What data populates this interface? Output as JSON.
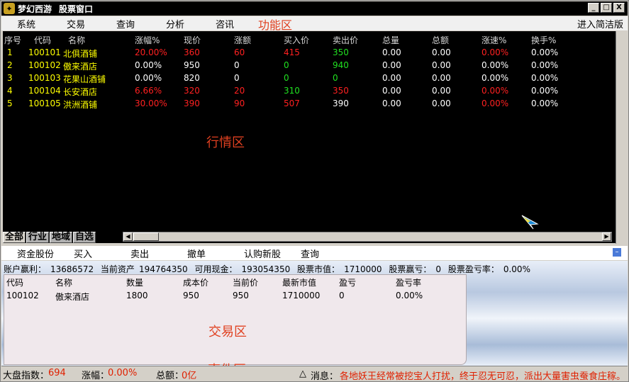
{
  "window": {
    "title": "梦幻西游",
    "subtitle": "股票窗口",
    "min": "_",
    "max": "□",
    "close": "X"
  },
  "menubar": {
    "items": [
      "系统",
      "交易",
      "查询",
      "分析",
      "咨讯"
    ],
    "zone_label": "功能区",
    "simple_mode": "进入简洁版"
  },
  "quote": {
    "headers": [
      "序号",
      "代码",
      "名称",
      "涨幅%",
      "现价",
      "涨额",
      "买入价",
      "卖出价",
      "总量",
      "总额",
      "涨速%",
      "换手%"
    ],
    "rows": [
      [
        "1",
        "100101",
        "北俱酒铺",
        "20.00%",
        "360",
        "60",
        "415",
        "350",
        "0.00",
        "0.00",
        "0.00%",
        "0.00%"
      ],
      [
        "2",
        "100102",
        "傲来酒店",
        "0.00%",
        "950",
        "0",
        "0",
        "940",
        "0.00",
        "0.00",
        "0.00%",
        "0.00%"
      ],
      [
        "3",
        "100103",
        "花果山酒铺",
        "0.00%",
        "820",
        "0",
        "0",
        "0",
        "0.00",
        "0.00",
        "0.00%",
        "0.00%"
      ],
      [
        "4",
        "100104",
        "长安酒店",
        "6.66%",
        "320",
        "20",
        "310",
        "350",
        "0.00",
        "0.00",
        "0.00%",
        "0.00%"
      ],
      [
        "5",
        "100105",
        "洪洲酒铺",
        "30.00%",
        "390",
        "90",
        "507",
        "390",
        "0.00",
        "0.00",
        "0.00%",
        "0.00%"
      ]
    ],
    "zone_label": "行情区"
  },
  "tabs": [
    "全部",
    "行业",
    "地域",
    "自选"
  ],
  "trademenu": {
    "items": [
      "资金股份",
      "买入",
      "卖出",
      "撤单",
      "认购新股",
      "查询"
    ]
  },
  "account": {
    "profit_label": "账户赢利：",
    "profit": "13686572",
    "assets_label": "当前资产",
    "assets": "194764350",
    "cash_label": "可用现金：",
    "cash": "193054350",
    "market_label": "股票市值：",
    "market": "1710000",
    "gain_label": "股票赢亏：",
    "gain": "0",
    "rate_label": "股票盈亏率：",
    "rate": "0.00%"
  },
  "holdings": {
    "headers": [
      "代码",
      "名称",
      "数量",
      "成本价",
      "当前价",
      "最新市值",
      "盈亏",
      "盈亏率"
    ],
    "rows": [
      [
        "100102",
        "傲来酒店",
        "1800",
        "950",
        "950",
        "1710000",
        "0",
        "0.00%"
      ]
    ],
    "zone_label": "交易区"
  },
  "events": {
    "zone_label": "事件区"
  },
  "status": {
    "index_label": "大盘指数：",
    "index": "694",
    "change_label": "涨幅：",
    "change": "0.00%",
    "total_label": "总额：",
    "total": "0亿",
    "msg_label": "消息：",
    "msg": "各地妖王经常被挖宝人打扰，终于忍无可忍，派出大量害虫蚕食庄稼。各地农"
  },
  "colors": {
    "up": "#ff2020",
    "down": "#20e020",
    "flat": "#ffffff",
    "quote_text": "#ffff00",
    "zone": "#e04020"
  }
}
